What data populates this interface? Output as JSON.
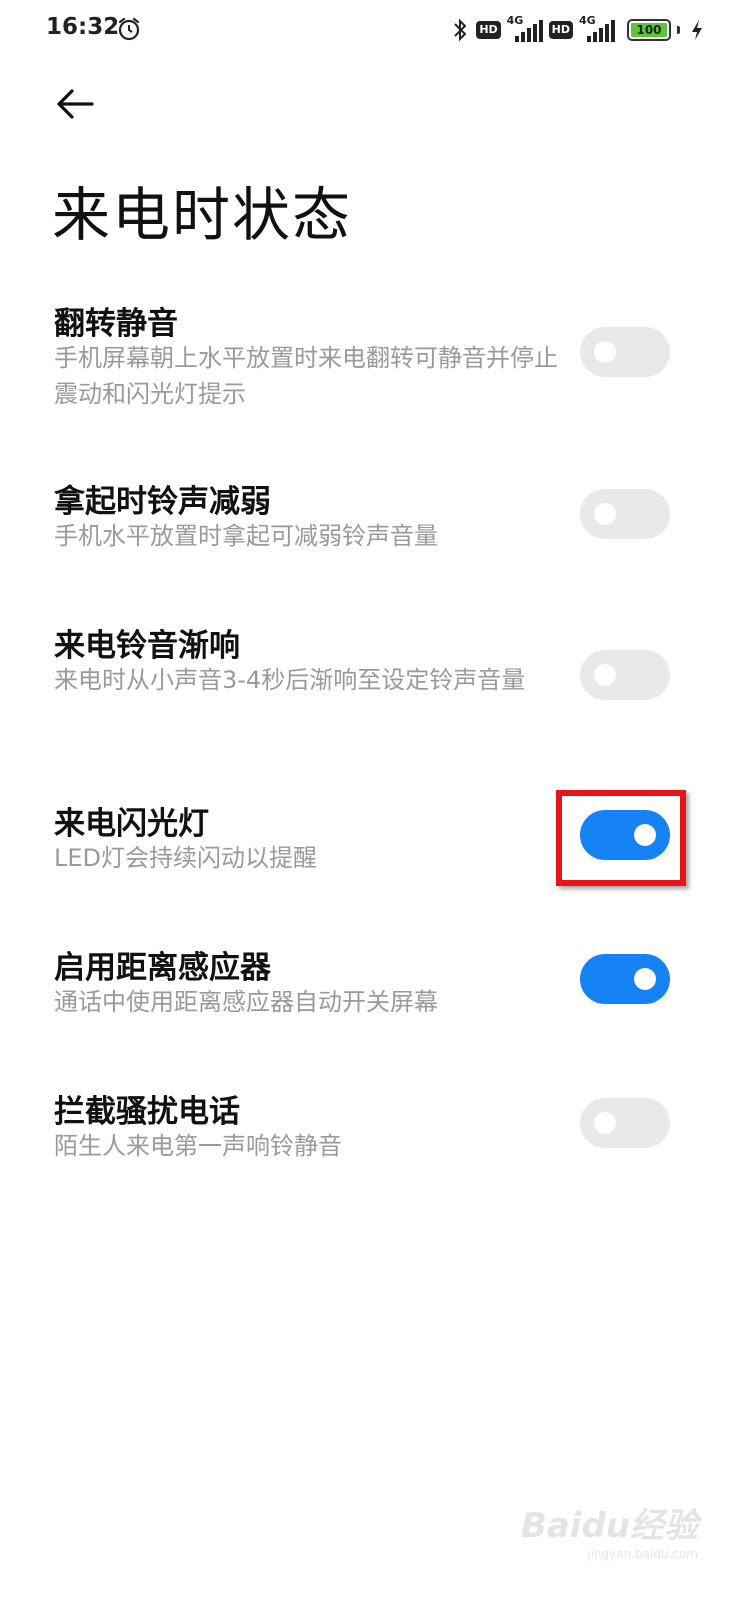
{
  "status_bar": {
    "time": "16:32",
    "network_1": "4G",
    "network_2": "4G",
    "hd_1": "HD",
    "hd_2": "HD",
    "battery": "100",
    "icons": [
      "alarm-icon",
      "bluetooth-icon",
      "signal-icon",
      "battery-icon",
      "charging-icon"
    ]
  },
  "header": {
    "back_icon": "back-arrow-icon",
    "title": "来电时状态"
  },
  "settings": [
    {
      "title": "翻转静音",
      "desc": "手机屏幕朝上水平放置时来电翻转可静音并停止震动和闪光灯提示",
      "enabled": false
    },
    {
      "title": "拿起时铃声减弱",
      "desc": "手机水平放置时拿起可减弱铃声音量",
      "enabled": false
    },
    {
      "title": "来电铃音渐响",
      "desc": "来电时从小声音3-4秒后渐响至设定铃声音量",
      "enabled": false
    },
    {
      "title": "来电闪光灯",
      "desc": "LED灯会持续闪动以提醒",
      "enabled": true
    },
    {
      "title": "启用距离感应器",
      "desc": "通话中使用距离感应器自动开关屏幕",
      "enabled": true
    },
    {
      "title": "拦截骚扰电话",
      "desc": "陌生人来电第一声响铃静音",
      "enabled": false
    }
  ],
  "colors": {
    "toggle_on": "#1582f5",
    "toggle_off": "#e9e9e9",
    "highlight": "#e8141c"
  },
  "watermark": {
    "brand": "Baidu经验",
    "url": "jingyan.baidu.com"
  }
}
